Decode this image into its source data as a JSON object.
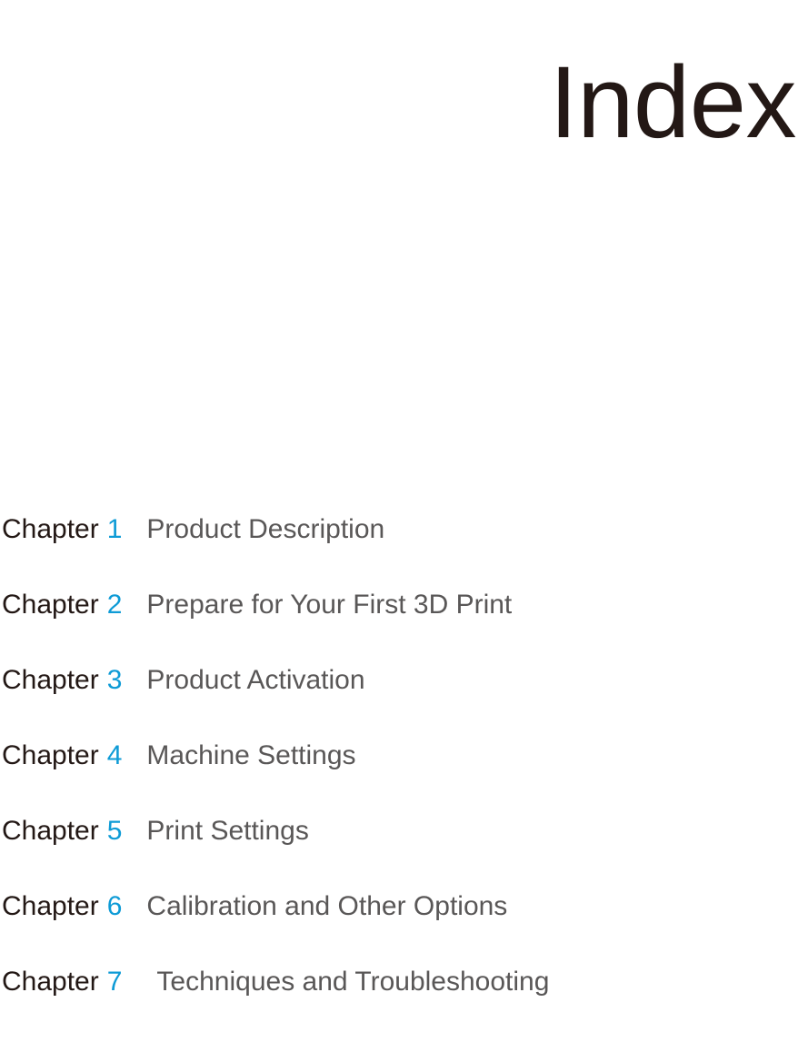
{
  "page": {
    "title": "Index",
    "background_color": "#ffffff"
  },
  "colors": {
    "title_text": "#231815",
    "chapter_label": "#231815",
    "chapter_number": "#0e9bd6",
    "chapter_title": "#595757"
  },
  "index": {
    "chapter_label": "Chapter",
    "entries": [
      {
        "label": "Chapter",
        "number": "1",
        "title": "Product Description"
      },
      {
        "label": "Chapter",
        "number": "2",
        "title": "Prepare for Your First 3D Print"
      },
      {
        "label": "Chapter",
        "number": "3",
        "title": "Product Activation"
      },
      {
        "label": "Chapter",
        "number": "4",
        "title": "Machine Settings"
      },
      {
        "label": "Chapter",
        "number": "5",
        "title": "Print Settings"
      },
      {
        "label": "Chapter",
        "number": "6",
        "title": "Calibration and Other Options"
      },
      {
        "label": "Chapter",
        "number": "7",
        "title": "Techniques and Troubleshooting"
      }
    ]
  }
}
